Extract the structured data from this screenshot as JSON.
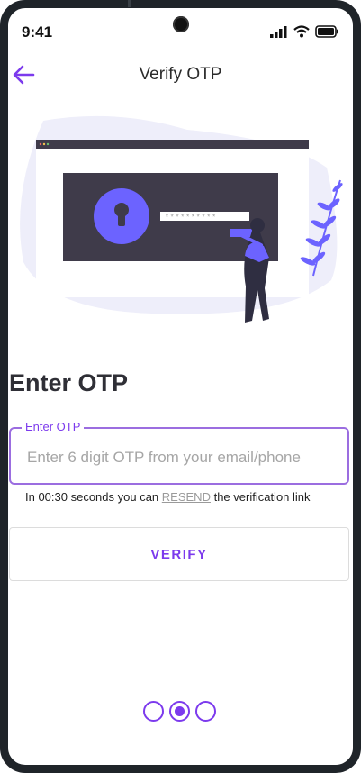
{
  "status_bar": {
    "time": "9:41"
  },
  "app_bar": {
    "title": "Verify OTP"
  },
  "heading": "Enter OTP",
  "otp_field": {
    "label": "Enter OTP",
    "placeholder": "Enter 6 digit OTP from your email/phone",
    "value": ""
  },
  "helper": {
    "prefix": "In 00:30 seconds you can ",
    "link": "RESEND",
    "suffix": " the verification link"
  },
  "verify_button": {
    "label": "VERIFY"
  },
  "pager": {
    "count": 3,
    "active_index": 1
  },
  "colors": {
    "accent": "#7c3aed",
    "illustration_dark": "#3f3b4a",
    "illustration_purple": "#6c63ff"
  },
  "icons": [
    "back-arrow-icon",
    "signal-icon",
    "wifi-icon",
    "battery-icon",
    "keyhole-icon"
  ]
}
